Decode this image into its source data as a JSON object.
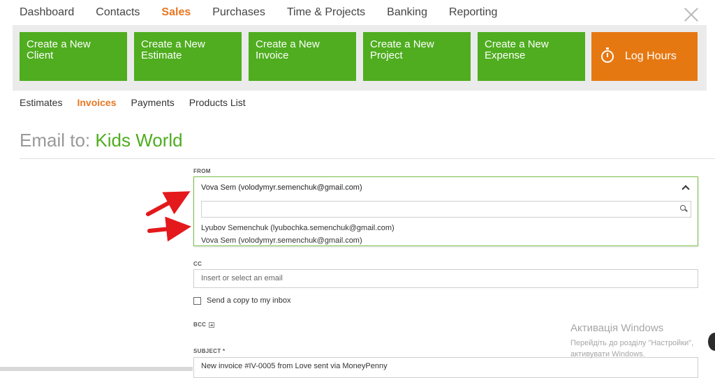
{
  "nav": {
    "items": [
      {
        "label": "Dashboard"
      },
      {
        "label": "Contacts"
      },
      {
        "label": "Sales"
      },
      {
        "label": "Purchases"
      },
      {
        "label": "Time & Projects"
      },
      {
        "label": "Banking"
      },
      {
        "label": "Reporting"
      }
    ],
    "close_icon": "close-icon"
  },
  "quick_actions": [
    {
      "label": "Create a New Client"
    },
    {
      "label": "Create a New Estimate"
    },
    {
      "label": "Create a New Invoice"
    },
    {
      "label": "Create a New Project"
    },
    {
      "label": "Create a New Expense"
    },
    {
      "label": "Log Hours",
      "icon": "stopwatch-icon"
    }
  ],
  "sub_nav": [
    {
      "label": "Estimates"
    },
    {
      "label": "Invoices"
    },
    {
      "label": "Payments"
    },
    {
      "label": "Products List"
    }
  ],
  "page": {
    "title_prefix": "Email to:",
    "client_name": "Kids World"
  },
  "form": {
    "from_label": "FROM",
    "from_selected": "Vova Sem (volodymyr.semenchuk@gmail.com)",
    "from_options": [
      "Lyubov Semenchuk (lyubochka.semenchuk@gmail.com)",
      "Vova Sem (volodymyr.semenchuk@gmail.com)"
    ],
    "cc_label": "CC",
    "cc_placeholder": "Insert or select an email",
    "copy_label": "Send a copy to my inbox",
    "bcc_label": "BCC",
    "subject_label": "SUBJECT *",
    "subject_value": "New invoice #IV-0005 from Love sent via MoneyPenny"
  },
  "watermark": {
    "title": "Активація Windows",
    "line1": "Перейдіть до розділу \"Настройки\",",
    "line2": "активувати Windows."
  },
  "colors": {
    "accent_orange": "#e87722",
    "action_green": "#4fad1f",
    "log_orange": "#e67812",
    "arrow_red": "#e3191c"
  }
}
